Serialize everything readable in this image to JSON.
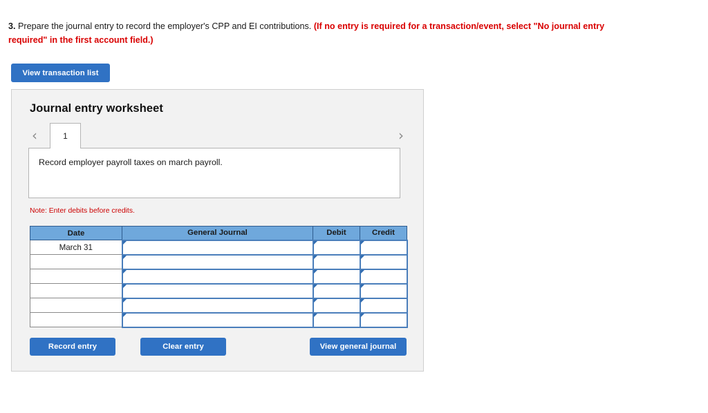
{
  "question": {
    "number": "3.",
    "text": "Prepare the journal entry to record the employer's CPP and EI contributions.",
    "hint": "(If no entry is required for a transaction/event, select \"No journal entry required\" in the first account field.)"
  },
  "toolbar": {
    "view_transaction_list_label": "View transaction list"
  },
  "panel": {
    "title": "Journal entry worksheet",
    "prev_icon": "chevron-left-icon",
    "next_icon": "chevron-right-icon",
    "tabs": [
      {
        "label": "1",
        "active": true
      }
    ],
    "description": "Record employer payroll taxes on march payroll.",
    "note": "Note: Enter debits before credits."
  },
  "table": {
    "columns": [
      "Date",
      "General Journal",
      "Debit",
      "Credit"
    ],
    "rows": [
      {
        "date": "March 31",
        "general_journal": "",
        "debit": "",
        "credit": ""
      },
      {
        "date": "",
        "general_journal": "",
        "debit": "",
        "credit": ""
      },
      {
        "date": "",
        "general_journal": "",
        "debit": "",
        "credit": ""
      },
      {
        "date": "",
        "general_journal": "",
        "debit": "",
        "credit": ""
      },
      {
        "date": "",
        "general_journal": "",
        "debit": "",
        "credit": ""
      },
      {
        "date": "",
        "general_journal": "",
        "debit": "",
        "credit": ""
      }
    ]
  },
  "footer": {
    "record_entry_label": "Record entry",
    "clear_entry_label": "Clear entry",
    "view_general_journal_label": "View general journal"
  },
  "colors": {
    "button_blue": "#3072c4",
    "header_blue": "#6fa8dc",
    "input_border_blue": "#4a7ebb",
    "hint_red": "#d90000",
    "note_red": "#cc0000",
    "panel_gray": "#f2f2f2"
  }
}
